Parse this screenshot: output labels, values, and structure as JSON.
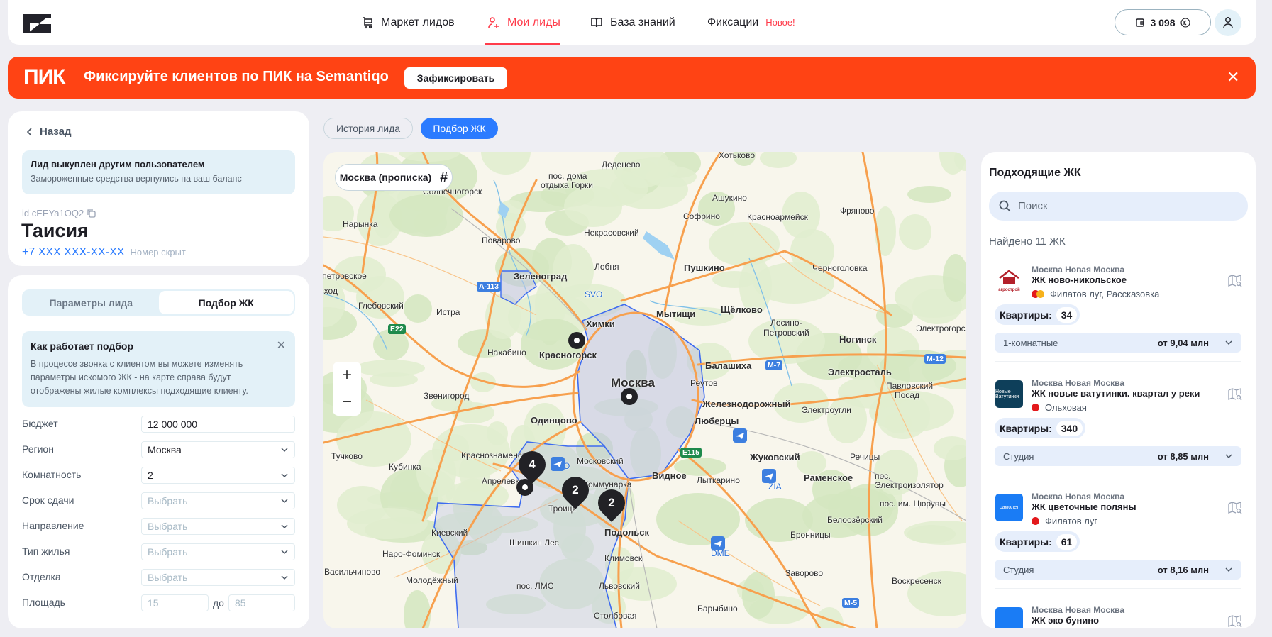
{
  "header": {
    "nav": [
      {
        "label": "Маркет лидов",
        "icon": "cart-icon"
      },
      {
        "label": "Мои лиды",
        "icon": "user-plus-icon"
      },
      {
        "label": "База знаний",
        "icon": "book-icon"
      },
      {
        "label": "Фиксации"
      }
    ],
    "new_badge": "Новое!",
    "balance": "3 098",
    "accent": "#FF3B4A"
  },
  "banner": {
    "brand": "ПИК",
    "text": "Фиксируйте клиентов по ПИК на Semantiqo",
    "button": "Зафиксировать",
    "close": "✕",
    "color": "#FF4314"
  },
  "lead": {
    "back": "Назад",
    "notice_title": "Лид выкуплен другим пользователем",
    "notice_text": "Замороженные средства вернулись на ваш баланс",
    "id": "id cEEYa1OQ2",
    "name": "Таисия",
    "phone": "+7 XXX XXX-XX-XX",
    "phone_note": "Номер скрыт"
  },
  "selection": {
    "tabs": [
      "Параметры лида",
      "Подбор ЖК"
    ],
    "how_title": "Как работает подбор",
    "how_text": "В процессе звонка с клиентом вы можете изменять параметры искомого ЖК - на карте справа будут отображены жилые комплексы подходящие клиенту.",
    "fields": [
      {
        "label": "Бюджет",
        "value": "12 000 000"
      },
      {
        "label": "Регион",
        "value": "Москва"
      },
      {
        "label": "Комнатность",
        "value": "2"
      },
      {
        "label": "Срок сдачи",
        "value": "Выбрать"
      },
      {
        "label": "Направление",
        "value": "Выбрать"
      },
      {
        "label": "Тип жилья",
        "value": "Выбрать"
      },
      {
        "label": "Отделка",
        "value": "Выбрать"
      }
    ],
    "area": {
      "label": "Площадь",
      "from": "15",
      "to_label": "до",
      "to": "85"
    }
  },
  "main_tabs": [
    "История лида",
    "Подбор ЖК"
  ],
  "map": {
    "region_chip": "Москва (прописка)",
    "zoom_in": "+",
    "zoom_out": "−",
    "clusters": [
      "4",
      "2",
      "2"
    ],
    "labels": [
      "Деденево",
      "пос. дома",
      "отдыха Горки",
      "Солнечногорск",
      "Нарынка",
      "Поварово",
      "Некрасовский",
      "Лобня",
      "Зеленоград",
      "SVO",
      "Новопетровское",
      "Восход",
      "Глебовский",
      "Истра",
      "Химки",
      "Нахабино",
      "Красногорск",
      "Москва",
      "Хотьково",
      "Ашукино",
      "Софрино",
      "Красноармейск",
      "Фряново",
      "Пушкино",
      "Черноголовка",
      "Мытищи",
      "Щёлково",
      "Лосино-",
      "Петровский",
      "Ногинск",
      "Электрогорск",
      "Балашиха",
      "Реутов",
      "Электросталь",
      "Павловский",
      "Посад",
      "Звенигород",
      "Одинцово",
      "Тучково",
      "Кубинка",
      "Краснознаменск",
      "Московский",
      "Апрелевка",
      "Коммунарка",
      "Троицк",
      "Киевский",
      "Шишкин Лес",
      "Подольск",
      "Наро-Фоминск",
      "Климовск",
      "Васильчиново",
      "Молодёжный",
      "пос. ЛМС",
      "Львовский",
      "Столбовая",
      "VKO",
      "Железнодорожный",
      "Электроугли",
      "Люберцы",
      "Жуковский",
      "Видное",
      "Лыткарино",
      "Раменское",
      "Речицы",
      "пос.",
      "Электроизолятор",
      "пос. им. Цюрупы",
      "Белоозёрский",
      "Бронницы",
      "Заворово",
      "Воскресенск",
      "Барыбино",
      "ZIA",
      "DME"
    ],
    "road_badges": [
      "A-113",
      "E22",
      "M-7",
      "M-12",
      "E115",
      "M-5"
    ]
  },
  "results": {
    "title": "Подходящие ЖК",
    "search_placeholder": "Поиск",
    "found": "Найдено 11 ЖК",
    "items": [
      {
        "region": "Москва Новая Москва",
        "name": "ЖК ново-никольское",
        "metro": "Филатов луг, Рассказовка",
        "flats_label": "Квартиры:",
        "flats": "34",
        "type": "1-комнатные",
        "price": "от 9,04 млн",
        "logo_text": "агрострой",
        "logo_color": "#ffffff"
      },
      {
        "region": "Москва Новая Москва",
        "name": "ЖК новые ватутинки. квартал у реки",
        "metro": "Ольховая",
        "flats_label": "Квартиры:",
        "flats": "340",
        "type": "Студия",
        "price": "от 8,85 млн",
        "logo_text": "Новые Ватутинки",
        "logo_color": "#0E3F5A"
      },
      {
        "region": "Москва Новая Москва",
        "name": "ЖК цветочные поляны",
        "metro": "Филатов луг",
        "flats_label": "Квартиры:",
        "flats": "61",
        "type": "Студия",
        "price": "от 8,16 млн",
        "logo_text": "самолет",
        "logo_color": "#1A7CF5"
      },
      {
        "region": "Москва Новая Москва",
        "name": "ЖК эко бунино",
        "logo_text": "",
        "logo_color": "#1A7CF5"
      }
    ]
  }
}
